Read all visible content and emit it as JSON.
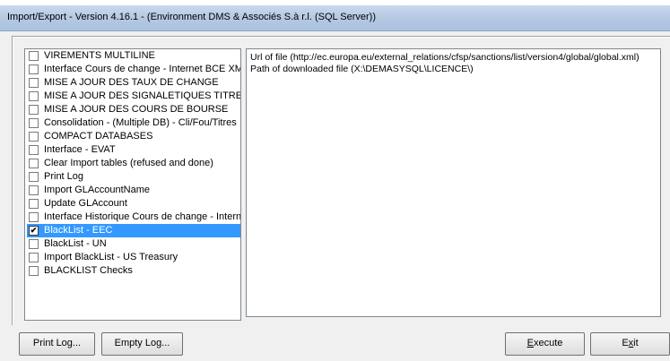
{
  "window": {
    "title": "Import/Export - Version 4.16.1 -  (Environment DMS & Associés S.à r.l. (SQL Server))"
  },
  "task_list": {
    "items": [
      {
        "label": "VIREMENTS MULTILINE",
        "checked": false
      },
      {
        "label": "Interface Cours de change - Internet BCE XML",
        "checked": false
      },
      {
        "label": "MISE A JOUR DES TAUX DE CHANGE",
        "checked": false
      },
      {
        "label": "MISE A JOUR DES SIGNALETIQUES TITRES",
        "checked": false
      },
      {
        "label": "MISE A JOUR DES COURS DE BOURSE",
        "checked": false
      },
      {
        "label": "Consolidation - (Multiple DB) - Cli/Fou/Titres",
        "checked": false
      },
      {
        "label": "COMPACT DATABASES",
        "checked": false
      },
      {
        "label": "Interface - EVAT",
        "checked": false
      },
      {
        "label": "Clear Import tables (refused and done)",
        "checked": false
      },
      {
        "label": "Print Log",
        "checked": false
      },
      {
        "label": "Import GLAccountName",
        "checked": false
      },
      {
        "label": "Update GLAccount",
        "checked": false
      },
      {
        "label": "Interface Historique Cours de change - Internet",
        "checked": false
      },
      {
        "label": "BlackList - EEC",
        "checked": true,
        "selected": true
      },
      {
        "label": "BlackList - UN",
        "checked": false
      },
      {
        "label": "Import BlackList - US Treasury",
        "checked": false
      },
      {
        "label": "BLACKLIST Checks",
        "checked": false
      }
    ]
  },
  "info_panel": {
    "lines": [
      "Url of file  (http://ec.europa.eu/external_relations/cfsp/sanctions/list/version4/global/global.xml)",
      "Path of downloaded file  (X:\\DEMASYSQL\\LICENCE\\)"
    ]
  },
  "buttons": {
    "print_log": "Print Log...",
    "empty_log": "Empty Log...",
    "execute": "Execute",
    "exit": "Exit"
  },
  "colors": {
    "selection": "#3399ff",
    "titlebar": "#b4c8e2",
    "background": "#f0f0f0"
  }
}
